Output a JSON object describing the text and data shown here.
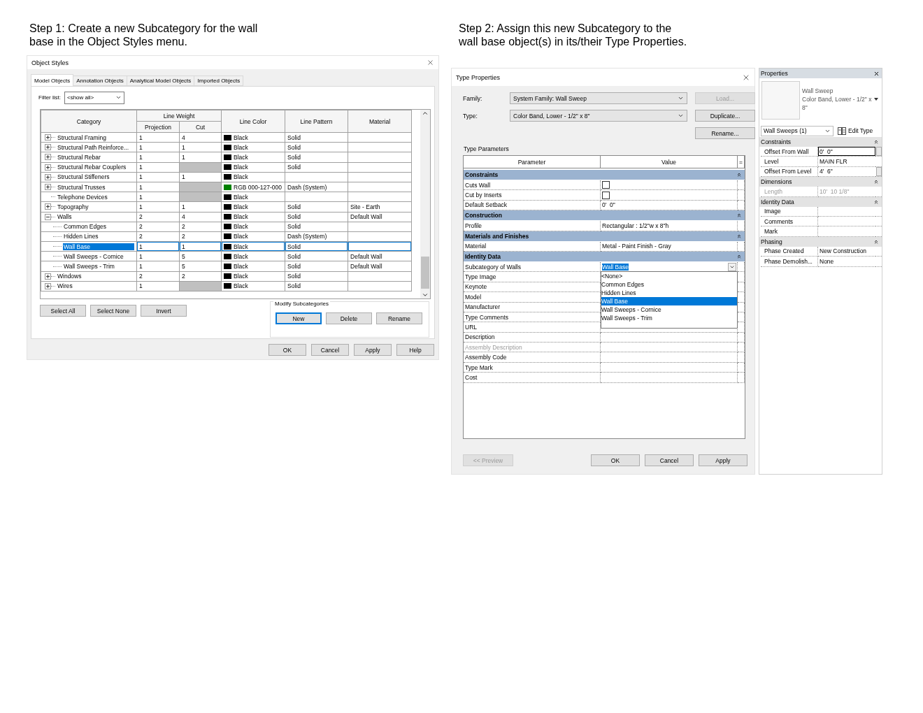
{
  "step_1_caption": "Step 1: Create a new Subcategory for the wall base in the Object Styles menu.",
  "object_styles": {
    "title": "Object Styles",
    "tabs": [
      {
        "label": "Model Objects",
        "selected": true
      },
      {
        "label": "Annotation Objects",
        "selected": false
      },
      {
        "label": "Analytical Model Objects",
        "selected": false
      },
      {
        "label": "Imported Objects",
        "selected": false
      }
    ],
    "filter": {
      "label": "Filter list:",
      "value": "<show all>"
    },
    "columns": {
      "category": "Category",
      "line_weight": "Line Weight",
      "projection": "Projection",
      "cut": "Cut",
      "line_color": "Line Color",
      "line_pattern": "Line Pattern",
      "material": "Material"
    },
    "rows": [
      {
        "category": "Structural Framing",
        "expandable": true,
        "projection": "1",
        "cut": "4",
        "cut_hatched": false,
        "color": "#000000",
        "line_color": "Black",
        "line_pattern": "Solid",
        "selected": false
      },
      {
        "category": "Structural Path Reinforce...",
        "expandable": true,
        "projection": "1",
        "cut": "1",
        "cut_hatched": false,
        "color": "#000000",
        "line_color": "Black",
        "line_pattern": "Solid",
        "selected": false
      },
      {
        "category": "Structural Rebar",
        "expandable": true,
        "projection": "1",
        "cut": "1",
        "cut_hatched": false,
        "color": "#000000",
        "line_color": "Black",
        "line_pattern": "Solid",
        "selected": false
      },
      {
        "category": "Structural Rebar Couplers",
        "expandable": true,
        "projection": "1",
        "cut_hatched": true,
        "color": "#000000",
        "line_color": "Black",
        "line_pattern": "Solid",
        "selected": false
      },
      {
        "category": "Structural Stiffeners",
        "expandable": true,
        "projection": "1",
        "cut": "1",
        "cut_hatched": false,
        "color": "#000000",
        "line_color": "Black",
        "selected": false
      },
      {
        "category": "Structural Trusses",
        "expandable": true,
        "projection": "1",
        "cut_hatched": true,
        "color": "#008000",
        "line_color": "RGB 000-127-000",
        "line_pattern": "Dash (System)",
        "selected": false
      },
      {
        "category": "Telephone Devices",
        "expandable": false,
        "projection": "1",
        "cut_hatched": true,
        "color": "#000000",
        "line_color": "Black",
        "selected": false
      },
      {
        "category": "Topography",
        "expandable": true,
        "projection": "1",
        "cut": "1",
        "cut_hatched": false,
        "color": "#000000",
        "line_color": "Black",
        "line_pattern": "Solid",
        "material": "Site - Earth",
        "selected": false
      },
      {
        "category": "Walls",
        "expandable": true,
        "expanded": true,
        "projection": "2",
        "cut": "4",
        "cut_hatched": false,
        "color": "#000000",
        "line_color": "Black",
        "line_pattern": "Solid",
        "material": "Default Wall",
        "selected": false,
        "children": [
          {
            "category": "Common Edges",
            "projection": "2",
            "cut": "2",
            "cut_hatched": false,
            "color": "#000000",
            "line_color": "Black",
            "line_pattern": "Solid",
            "selected": false
          },
          {
            "category": "Hidden Lines",
            "projection": "2",
            "cut": "2",
            "cut_hatched": false,
            "color": "#000000",
            "line_color": "Black",
            "line_pattern": "Dash (System)",
            "selected": false
          },
          {
            "category": "Wall Base",
            "projection": "1",
            "cut": "1",
            "cut_hatched": false,
            "color": "#000000",
            "line_color": "Black",
            "line_pattern": "Solid",
            "selected": true
          },
          {
            "category": "Wall Sweeps - Cornice",
            "projection": "1",
            "cut": "5",
            "cut_hatched": false,
            "color": "#000000",
            "line_color": "Black",
            "line_pattern": "Solid",
            "material": "Default Wall",
            "selected": false
          },
          {
            "category": "Wall Sweeps - Trim",
            "projection": "1",
            "cut": "5",
            "cut_hatched": false,
            "color": "#000000",
            "line_color": "Black",
            "line_pattern": "Solid",
            "material": "Default Wall",
            "selected": false
          }
        ]
      },
      {
        "category": "Windows",
        "expandable": true,
        "projection": "2",
        "cut": "2",
        "cut_hatched": false,
        "color": "#000000",
        "line_color": "Black",
        "line_pattern": "Solid",
        "selected": false
      },
      {
        "category": "Wires",
        "expandable": true,
        "projection": "1",
        "cut_hatched": true,
        "color": "#000000",
        "line_color": "Black",
        "line_pattern": "Solid",
        "selected": false
      }
    ],
    "select_buttons": [
      "Select All",
      "Select None",
      "Invert"
    ],
    "modify": {
      "label": "Modify Subcategories",
      "buttons": [
        {
          "label": "New",
          "focused": true
        },
        {
          "label": "Delete",
          "focused": false
        },
        {
          "label": "Rename",
          "focused": false
        }
      ]
    },
    "footer_buttons": [
      "OK",
      "Cancel",
      "Apply",
      "Help"
    ]
  },
  "step_2_caption": "Step 2: Assign this new Subcategory to the wall base object(s) in its/their Type Properties.",
  "type_properties": {
    "title": "Type Properties",
    "family": {
      "label": "Family:",
      "value": "System Family: Wall Sweep"
    },
    "type": {
      "label": "Type:",
      "value": "Color Band, Lower - 1/2\" x 8\""
    },
    "side_buttons": [
      {
        "label": "Load...",
        "disabled": true
      },
      {
        "label": "Duplicate...",
        "disabled": false
      },
      {
        "label": "Rename...",
        "disabled": false
      }
    ],
    "section_label": "Type Parameters",
    "columns": [
      "Parameter",
      "Value"
    ],
    "equals": "=",
    "groups": [
      {
        "name": "Constraints",
        "rows": [
          {
            "name": "Cuts Wall",
            "kind": "checkbox",
            "checked": false,
            "disabled": false
          },
          {
            "name": "Cut by Inserts",
            "kind": "checkbox",
            "checked": false,
            "disabled": false
          },
          {
            "name": "Default Setback",
            "kind": "text",
            "value": "0'  0\"",
            "disabled": false
          }
        ]
      },
      {
        "name": "Construction",
        "rows": [
          {
            "name": "Profile",
            "kind": "text",
            "value": "Rectangular : 1/2\"w x 8\"h",
            "disabled": false
          }
        ]
      },
      {
        "name": "Materials and Finishes",
        "rows": [
          {
            "name": "Material",
            "kind": "text",
            "value": "Metal - Paint Finish - Gray",
            "disabled": false
          }
        ]
      },
      {
        "name": "Identity Data",
        "rows": [
          {
            "name": "Subcategory of Walls",
            "kind": "dropdown",
            "value": "Wall Base",
            "disabled": false,
            "options": [
              {
                "label": "<None>",
                "selected": false
              },
              {
                "label": "Common Edges",
                "selected": false
              },
              {
                "label": "Hidden Lines",
                "selected": false
              },
              {
                "label": "Wall Base",
                "selected": true
              },
              {
                "label": "Wall Sweeps - Cornice",
                "selected": false
              },
              {
                "label": "Wall Sweeps - Trim",
                "selected": false
              }
            ]
          },
          {
            "name": "Type Image",
            "kind": "text",
            "disabled": false
          },
          {
            "name": "Keynote",
            "kind": "text",
            "disabled": false
          },
          {
            "name": "Model",
            "kind": "text",
            "disabled": false
          },
          {
            "name": "Manufacturer",
            "kind": "text",
            "disabled": false
          },
          {
            "name": "Type Comments",
            "kind": "text",
            "disabled": false
          },
          {
            "name": "URL",
            "kind": "text",
            "disabled": false
          },
          {
            "name": "Description",
            "kind": "text",
            "disabled": false
          },
          {
            "name": "Assembly Description",
            "kind": "text",
            "disabled": true
          },
          {
            "name": "Assembly Code",
            "kind": "text",
            "disabled": false
          },
          {
            "name": "Type Mark",
            "kind": "text",
            "disabled": false
          },
          {
            "name": "Cost",
            "kind": "text",
            "disabled": false
          }
        ]
      }
    ],
    "bottom_buttons": [
      {
        "label": "<< Preview",
        "disabled": true
      },
      {
        "label": "OK",
        "disabled": false
      },
      {
        "label": "Cancel",
        "disabled": false
      },
      {
        "label": "Apply",
        "disabled": false
      }
    ]
  },
  "properties_panel": {
    "title": "Properties",
    "family": "Wall Sweep",
    "type": "Color Band, Lower - 1/2\" x 8\"",
    "selector": "Wall Sweeps (1)",
    "edit_type": "Edit Type",
    "groups": [
      {
        "name": "Constraints",
        "rows": [
          {
            "name": "Offset From Wall",
            "value": "0'  0\"",
            "editing": true,
            "disabled": false,
            "has_button": true
          },
          {
            "name": "Level",
            "value": "MAIN FLR",
            "editing": false,
            "disabled": false
          },
          {
            "name": "Offset From Level",
            "value": "4'  6\"",
            "editing": false,
            "disabled": false,
            "has_button": true
          }
        ]
      },
      {
        "name": "Dimensions",
        "rows": [
          {
            "name": "Length",
            "value": "10'  10 1/8\"",
            "editing": false,
            "disabled": true
          }
        ]
      },
      {
        "name": "Identity Data",
        "rows": [
          {
            "name": "Image",
            "editing": false,
            "disabled": false
          },
          {
            "name": "Comments",
            "editing": false,
            "disabled": false
          },
          {
            "name": "Mark",
            "editing": false,
            "disabled": false
          }
        ]
      },
      {
        "name": "Phasing",
        "rows": [
          {
            "name": "Phase Created",
            "value": "New Construction",
            "editing": false,
            "disabled": false
          },
          {
            "name": "Phase Demolish...",
            "value": "None",
            "editing": false,
            "disabled": false
          }
        ]
      }
    ]
  }
}
